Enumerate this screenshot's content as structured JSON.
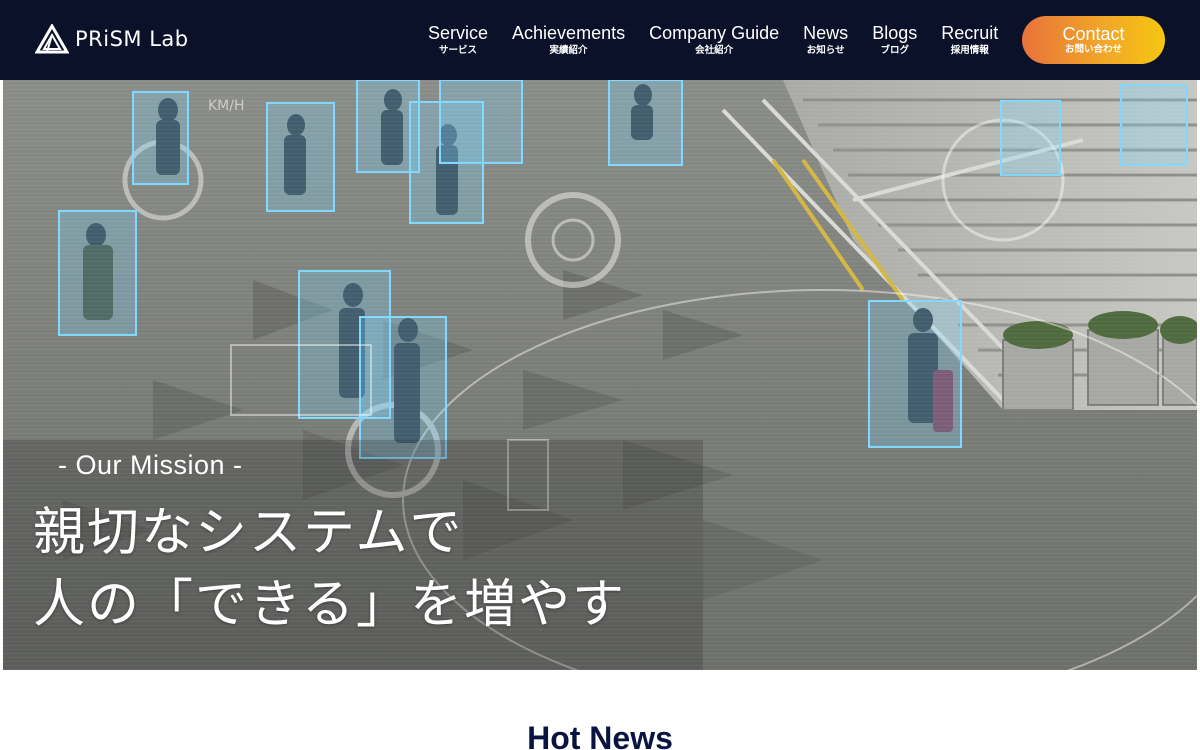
{
  "header": {
    "logo_text": "PRiSM Lab",
    "nav": [
      {
        "en": "Service",
        "ja": "サービス"
      },
      {
        "en": "Achievements",
        "ja": "実績紹介"
      },
      {
        "en": "Company Guide",
        "ja": "会社紹介"
      },
      {
        "en": "News",
        "ja": "お知らせ"
      },
      {
        "en": "Blogs",
        "ja": "ブログ"
      },
      {
        "en": "Recruit",
        "ja": "採用情報"
      }
    ],
    "contact": {
      "en": "Contact",
      "ja": "お問い合わせ"
    }
  },
  "hero": {
    "mission_label": "- Our Mission -",
    "mission_line1": "親切なシステムで",
    "mission_line2": "人の「できる」を増やす",
    "hud_labels": [
      "KM/H"
    ]
  },
  "hot_news": {
    "title": "Hot News"
  },
  "colors": {
    "header_bg": "#0a1128",
    "contact_gradient_start": "#e8733a",
    "contact_gradient_end": "#f5c60f",
    "detection_box": "#7fd8ff",
    "section_title": "#0a1440"
  }
}
